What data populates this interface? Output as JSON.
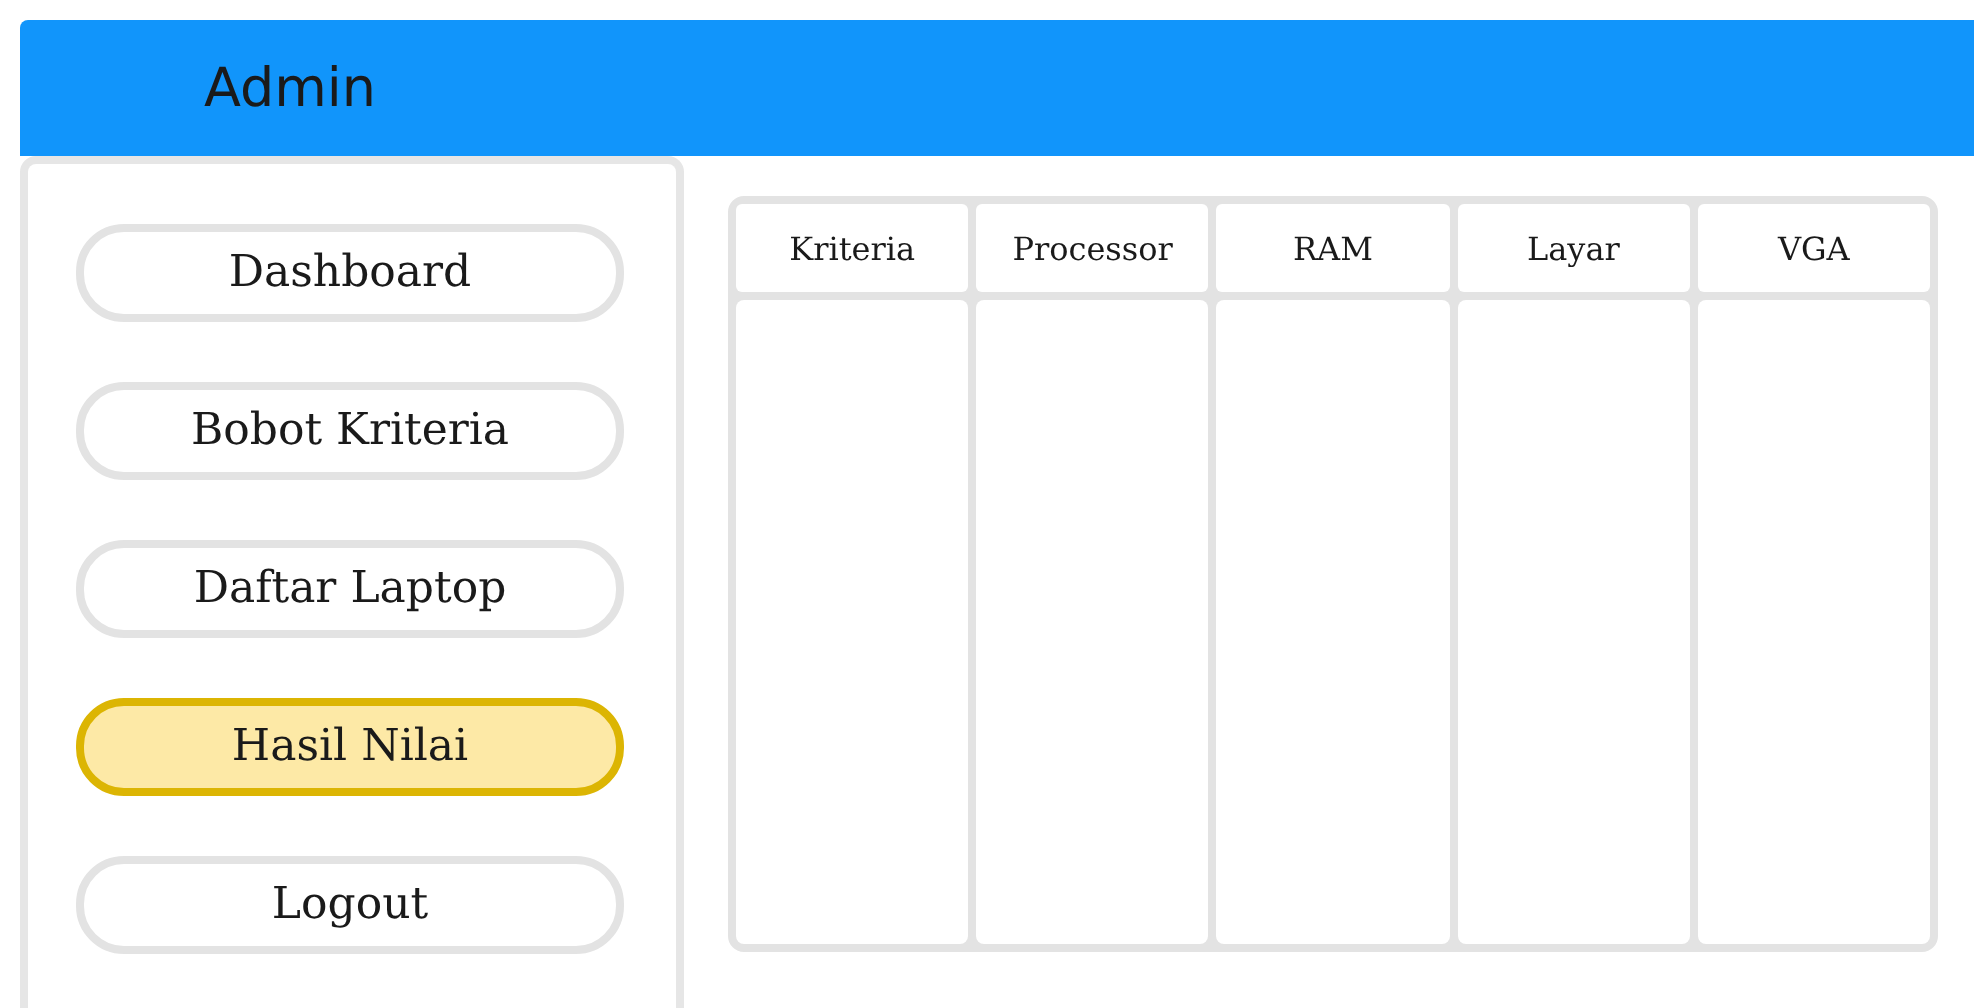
{
  "header": {
    "title": "Admin"
  },
  "sidebar": {
    "items": [
      {
        "label": "Dashboard",
        "selected": false
      },
      {
        "label": "Bobot Kriteria",
        "selected": false
      },
      {
        "label": "Daftar Laptop",
        "selected": false
      },
      {
        "label": "Hasil Nilai",
        "selected": true
      },
      {
        "label": "Logout",
        "selected": false
      }
    ]
  },
  "table": {
    "columns": [
      "Kriteria",
      "Processor",
      "RAM",
      "Layar",
      "VGA"
    ]
  }
}
